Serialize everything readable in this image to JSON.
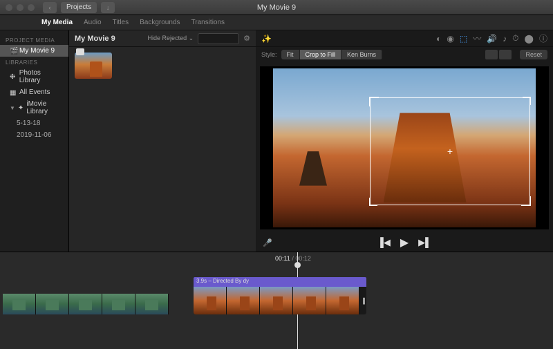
{
  "titlebar": {
    "window_title": "My Movie 9",
    "projects_btn": "Projects"
  },
  "tabs": {
    "my_media": "My Media",
    "audio": "Audio",
    "titles": "Titles",
    "backgrounds": "Backgrounds",
    "transitions": "Transitions"
  },
  "sidebar": {
    "hdr_project": "PROJECT MEDIA",
    "project_name": "My Movie 9",
    "hdr_libraries": "LIBRARIES",
    "photos": "Photos Library",
    "all_events": "All Events",
    "imovie_lib": "iMovie Library",
    "date1": "5-13-18",
    "date2": "2019-11-06"
  },
  "browser": {
    "title": "My Movie 9",
    "hide_rejected": "Hide Rejected"
  },
  "viewer": {
    "style_label": "Style:",
    "fit": "Fit",
    "crop_to_fill": "Crop to Fill",
    "ken_burns": "Ken Burns",
    "reset": "Reset"
  },
  "timeline": {
    "current": "00:11",
    "total": "00:12",
    "clip2_label": "3.9s – Directed By dy"
  }
}
